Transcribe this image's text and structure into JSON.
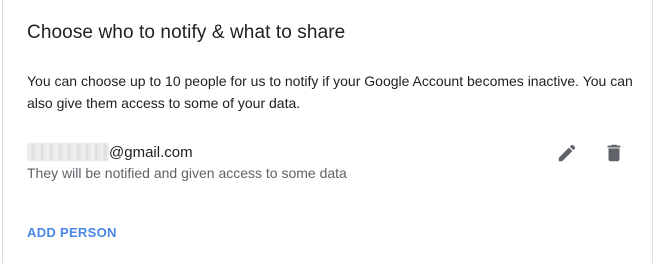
{
  "section": {
    "title": "Choose who to notify & what to share",
    "description": "You can choose up to 10 people for us to notify if your Google Account becomes inactive. You can also give them access to some of your data."
  },
  "person": {
    "email_domain": "@gmail.com",
    "status": "They will be notified and given access to some data",
    "edit_icon": "pencil-icon",
    "delete_icon": "trash-icon"
  },
  "actions": {
    "add_person_label": "ADD PERSON"
  },
  "colors": {
    "text_primary": "#202124",
    "text_secondary": "#5f6368",
    "icon": "#5f6368",
    "link": "#4a86e8",
    "border": "#dadce0"
  }
}
